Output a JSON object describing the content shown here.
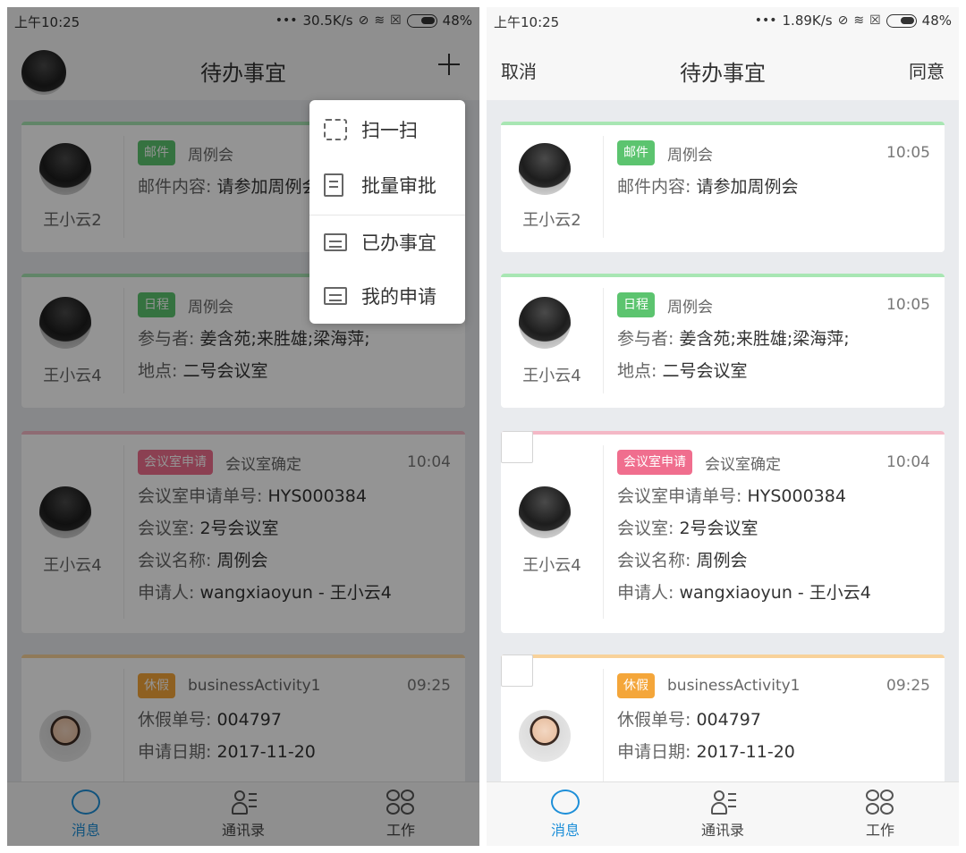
{
  "status_left": {
    "time": "上午10:25",
    "speed": "30.5K/s",
    "battery": "48%"
  },
  "status_right": {
    "time": "上午10:25",
    "speed": "1.89K/s",
    "battery": "48%"
  },
  "title": "待办事宜",
  "nav_right": {
    "cancel": "取消",
    "agree": "同意"
  },
  "menu": {
    "items": [
      {
        "label": "扫一扫",
        "icon": "scan-icon"
      },
      {
        "label": "批量审批",
        "icon": "batch-approve-icon"
      },
      {
        "label": "已办事宜",
        "icon": "done-list-icon"
      },
      {
        "label": "我的申请",
        "icon": "my-request-icon"
      }
    ]
  },
  "cards": [
    {
      "name": "王小云2",
      "tag": "邮件",
      "tag_color": "#5cc46f",
      "line_color": "#a8e6b3",
      "subject": "周例会",
      "time": "10:05",
      "rows": [
        {
          "label": "邮件内容:",
          "value": "请参加周例会"
        }
      ]
    },
    {
      "name": "王小云4",
      "tag": "日程",
      "tag_color": "#5cc46f",
      "line_color": "#a8e6b3",
      "subject": "周例会",
      "time": "10:05",
      "rows": [
        {
          "label": "参与者:",
          "value": "姜含苑;来胜雄;梁海萍;"
        },
        {
          "label": "地点:",
          "value": "二号会议室"
        }
      ]
    },
    {
      "name": "王小云4",
      "tag": "会议室申请",
      "tag_color": "#f06e8e",
      "line_color": "#f4b8c6",
      "subject": "会议室确定",
      "time": "10:04",
      "rows": [
        {
          "label": "会议室申请单号:",
          "value": "HYS000384"
        },
        {
          "label": "会议室:",
          "value": "2号会议室"
        },
        {
          "label": "会议名称:",
          "value": "周例会"
        },
        {
          "label": "申请人:",
          "value": "wangxiaoyun - 王小云4"
        }
      ]
    },
    {
      "name": "王小云4",
      "tag": "休假",
      "tag_color": "#f4a63a",
      "line_color": "#f8d29a",
      "subject": "businessActivity1",
      "time": "09:25",
      "rows": [
        {
          "label": "休假单号:",
          "value": "004797"
        },
        {
          "label": "申请日期:",
          "value": "2017-11-20"
        }
      ]
    }
  ],
  "tabs": [
    {
      "label": "消息",
      "icon": "message-icon"
    },
    {
      "label": "通讯录",
      "icon": "contacts-icon"
    },
    {
      "label": "工作",
      "icon": "work-icon"
    }
  ]
}
